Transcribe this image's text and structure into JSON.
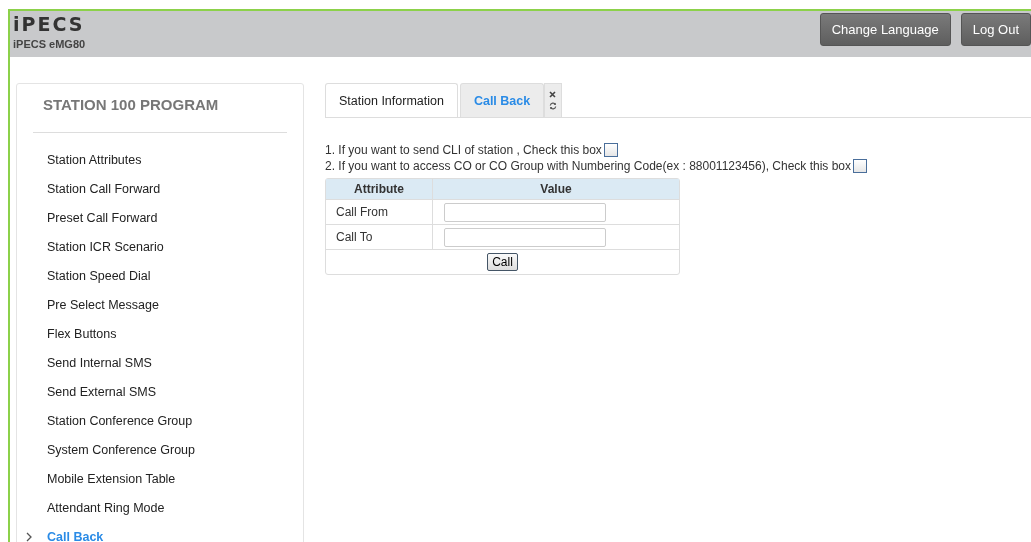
{
  "header": {
    "logo": "iPECS",
    "product": "iPECS eMG80",
    "buttons": [
      "Change Language",
      "Log Out"
    ]
  },
  "sidebar": {
    "title": "STATION 100 PROGRAM",
    "items": [
      {
        "label": "Station Attributes",
        "selected": false
      },
      {
        "label": "Station Call Forward",
        "selected": false
      },
      {
        "label": "Preset Call Forward",
        "selected": false
      },
      {
        "label": "Station ICR Scenario",
        "selected": false
      },
      {
        "label": "Station Speed Dial",
        "selected": false
      },
      {
        "label": "Pre Select Message",
        "selected": false
      },
      {
        "label": "Flex Buttons",
        "selected": false
      },
      {
        "label": "Send Internal SMS",
        "selected": false
      },
      {
        "label": "Send External SMS",
        "selected": false
      },
      {
        "label": "Station Conference Group",
        "selected": false
      },
      {
        "label": "System Conference Group",
        "selected": false
      },
      {
        "label": "Mobile Extension Table",
        "selected": false
      },
      {
        "label": "Attendant Ring Mode",
        "selected": false
      },
      {
        "label": "Call Back",
        "selected": true
      }
    ]
  },
  "tabs": [
    {
      "label": "Station Information",
      "selected": false,
      "closable": false
    },
    {
      "label": "Call Back",
      "selected": true,
      "closable": true
    }
  ],
  "options": [
    {
      "text": "1. If you want to send CLI of station , Check this box",
      "checked": false
    },
    {
      "text": "2. If you want to access CO or CO Group with Numbering Code(ex : 88001123456), Check this box",
      "checked": false
    }
  ],
  "table": {
    "columns": [
      "Attribute",
      "Value"
    ],
    "rows": [
      {
        "attribute": "Call From"
      },
      {
        "attribute": "Call To"
      }
    ],
    "button": "Call"
  }
}
